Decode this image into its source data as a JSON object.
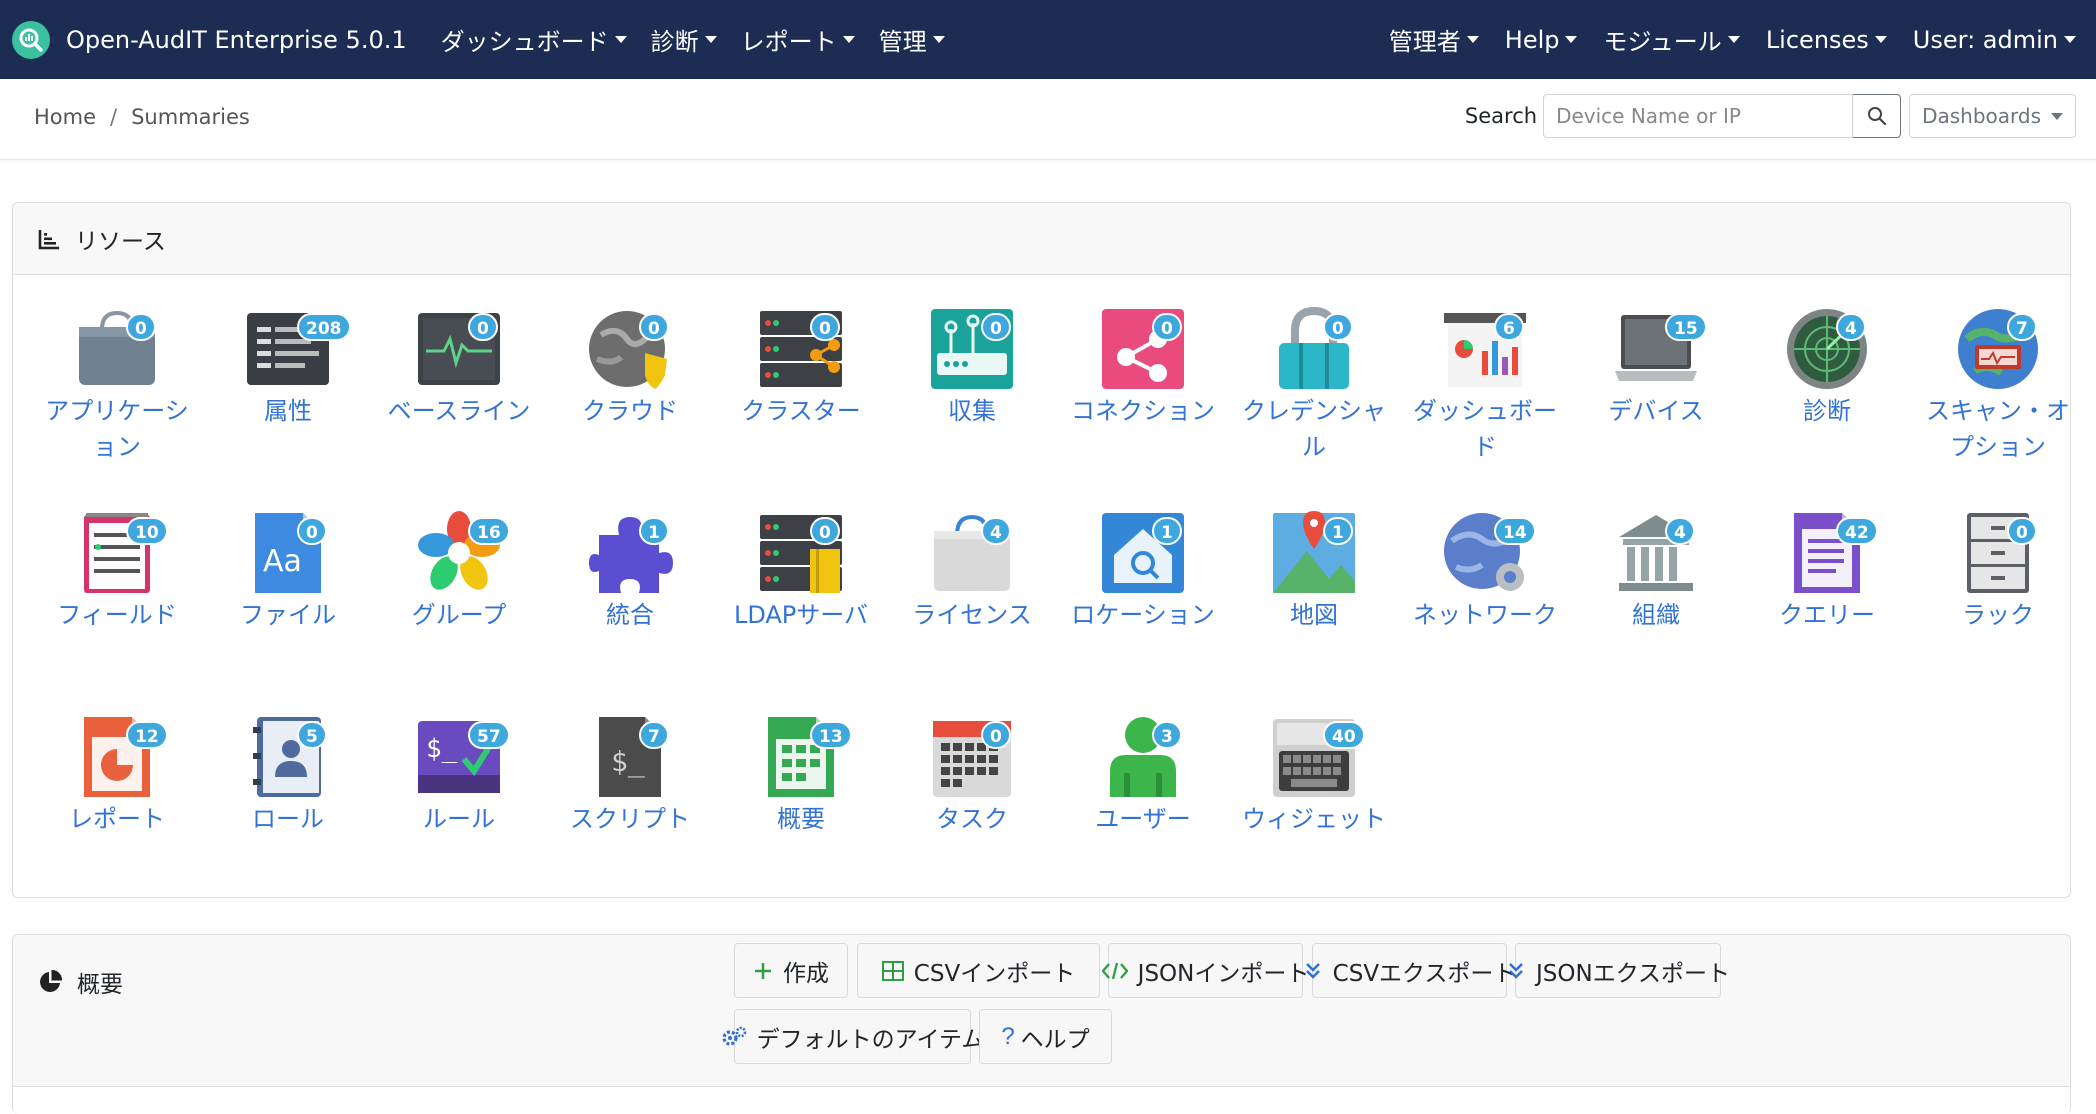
{
  "navbar": {
    "title": "Open-AudIT Enterprise 5.0.1",
    "menu": [
      "ダッシュボード",
      "診断",
      "レポート",
      "管理"
    ],
    "right_menu": [
      "管理者",
      "Help",
      "モジュール",
      "Licenses",
      "User: admin"
    ]
  },
  "breadcrumb": {
    "home": "Home",
    "separator": "/",
    "current": "Summaries"
  },
  "search": {
    "label": "Search",
    "placeholder": "Device Name or IP",
    "dashboards_label": "Dashboards"
  },
  "resources": {
    "title": "リソース",
    "items": [
      {
        "label": "アプリケーション",
        "count": "0",
        "icon": "bag-icon"
      },
      {
        "label": "属性",
        "count": "208",
        "icon": "list-icon"
      },
      {
        "label": "ベースライン",
        "count": "0",
        "icon": "pulse-monitor-icon"
      },
      {
        "label": "クラウド",
        "count": "0",
        "icon": "globe-shield-icon"
      },
      {
        "label": "クラスター",
        "count": "0",
        "icon": "server-share-icon"
      },
      {
        "label": "収集",
        "count": "0",
        "icon": "router-icon"
      },
      {
        "label": "コネクション",
        "count": "0",
        "icon": "share-icon"
      },
      {
        "label": "クレデンシャル",
        "count": "0",
        "icon": "padlock-icon"
      },
      {
        "label": "ダッシュボード",
        "count": "6",
        "icon": "dashboard-chart-icon"
      },
      {
        "label": "デバイス",
        "count": "15",
        "icon": "laptop-icon"
      },
      {
        "label": "診断",
        "count": "4",
        "icon": "radar-icon"
      },
      {
        "label": "スキャン・オプション",
        "count": "7",
        "icon": "globe-scan-icon"
      },
      {
        "label": "フィールド",
        "count": "10",
        "icon": "notepad-icon"
      },
      {
        "label": "ファイル",
        "count": "0",
        "icon": "file-icon"
      },
      {
        "label": "グループ",
        "count": "16",
        "icon": "flower-icon"
      },
      {
        "label": "統合",
        "count": "1",
        "icon": "puzzle-icon"
      },
      {
        "label": "LDAPサーバ",
        "count": "0",
        "icon": "server-book-icon"
      },
      {
        "label": "ライセンス",
        "count": "4",
        "icon": "shopping-bag-icon"
      },
      {
        "label": "ロケーション",
        "count": "1",
        "icon": "home-search-icon"
      },
      {
        "label": "地図",
        "count": "1",
        "icon": "map-pin-icon"
      },
      {
        "label": "ネットワーク",
        "count": "14",
        "icon": "globe-gear-icon"
      },
      {
        "label": "組織",
        "count": "4",
        "icon": "bank-icon"
      },
      {
        "label": "クエリー",
        "count": "42",
        "icon": "document-icon"
      },
      {
        "label": "ラック",
        "count": "0",
        "icon": "cabinet-icon"
      },
      {
        "label": "レポート",
        "count": "12",
        "icon": "pie-report-icon"
      },
      {
        "label": "ロール",
        "count": "5",
        "icon": "contact-book-icon"
      },
      {
        "label": "ルール",
        "count": "57",
        "icon": "terminal-check-icon"
      },
      {
        "label": "スクリプト",
        "count": "7",
        "icon": "script-file-icon"
      },
      {
        "label": "概要",
        "count": "13",
        "icon": "spreadsheet-icon"
      },
      {
        "label": "タスク",
        "count": "0",
        "icon": "calendar-icon"
      },
      {
        "label": "ユーザー",
        "count": "3",
        "icon": "user-icon"
      },
      {
        "label": "ウィジェット",
        "count": "40",
        "icon": "keyboard-icon"
      }
    ]
  },
  "summaries": {
    "title": "概要",
    "buttons": {
      "create": "作成",
      "csv_import": "CSVインポート",
      "json_import": "JSONインポート",
      "csv_export": "CSVエクスポート",
      "json_export": "JSONエクスポート",
      "defaults": "デフォルトのアイテム",
      "help": "ヘルプ"
    }
  },
  "colors": {
    "navbar": "#1c2c52",
    "link": "#3273d6",
    "badge": "#3da7de",
    "card_header": "#f8f8f8"
  }
}
